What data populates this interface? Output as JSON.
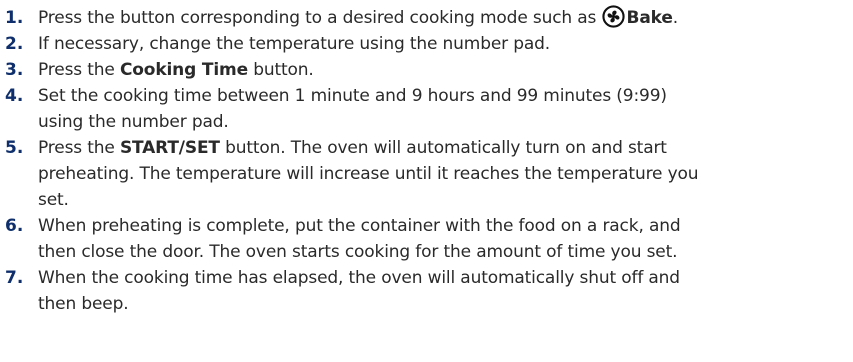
{
  "steps": [
    {
      "number": "1.",
      "text_before": "Press the button corresponding to a desired cooking mode such as ",
      "icon": "convection-fan-icon",
      "bold": "Bake",
      "text_after": "."
    },
    {
      "number": "2.",
      "text": "If necessary, change the temperature using the number pad."
    },
    {
      "number": "3.",
      "text_before": "Press the ",
      "bold": "Cooking Time",
      "text_after": " button."
    },
    {
      "number": "4.",
      "line1": "Set the cooking time between 1 minute and 9 hours and 99 minutes (9:99)",
      "line2": "using the number pad."
    },
    {
      "number": "5.",
      "text_before": "Press the ",
      "bold": "START/SET",
      "text_after": " button. The oven will automatically turn on and start",
      "line2": "preheating. The temperature will increase until it reaches the temperature you",
      "line3": "set."
    },
    {
      "number": "6.",
      "line1": "When preheating is complete, put the container with the food on a rack, and",
      "line2": "then close the door. The oven starts cooking for the amount of time you set."
    },
    {
      "number": "7.",
      "line1": "When the cooking time has elapsed, the oven will automatically shut off and",
      "line2": "then beep."
    }
  ]
}
